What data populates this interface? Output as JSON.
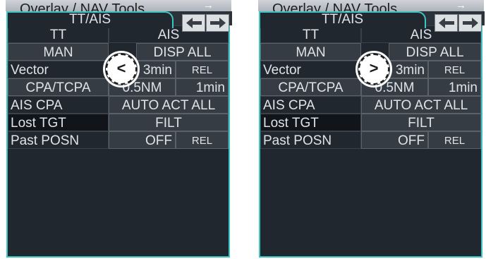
{
  "panels": [
    {
      "title": "Overlay / NAV Tools",
      "header_arrow": "→",
      "tab_label": "TT/AIS",
      "callout_symbol": "<",
      "rows": {
        "tt": "TT",
        "ais": "AIS",
        "man": "MAN",
        "disp_all": "DISP ALL",
        "vector_label": "Vector",
        "vector_value": "3min",
        "vector_mode": "REL",
        "cpa_tcpa_label": "CPA/TCPA",
        "cpa_value": "0.5NM",
        "tcpa_value": "1min",
        "ais_cpa_label": "AIS CPA",
        "ais_cpa_value": "AUTO ACT ALL",
        "lost_tgt_label": "Lost TGT",
        "lost_tgt_value": "FILT",
        "past_posn_label": "Past POSN",
        "past_posn_value": "OFF",
        "past_posn_mode": "REL"
      }
    },
    {
      "title": "Overlay / NAV Tools",
      "header_arrow": "→",
      "tab_label": "TT/AIS",
      "callout_symbol": ">",
      "rows": {
        "tt": "TT",
        "ais": "AIS",
        "man": "MAN",
        "disp_all": "DISP ALL",
        "vector_label": "Vector",
        "vector_value": "3min",
        "vector_mode": "REL",
        "cpa_tcpa_label": "CPA/TCPA",
        "cpa_value": "0.5NM",
        "tcpa_value": "1min",
        "ais_cpa_label": "AIS CPA",
        "ais_cpa_value": "AUTO ACT ALL",
        "lost_tgt_label": "Lost TGT",
        "lost_tgt_value": "FILT",
        "past_posn_label": "Past POSN",
        "past_posn_value": "OFF",
        "past_posn_mode": "REL"
      }
    }
  ],
  "icons": {
    "prev": "arrow-left-icon",
    "next": "arrow-right-icon"
  },
  "colors": {
    "accent": "#3fc4c4",
    "panel_bg": "#21272e",
    "text": "#dfe3e7"
  }
}
